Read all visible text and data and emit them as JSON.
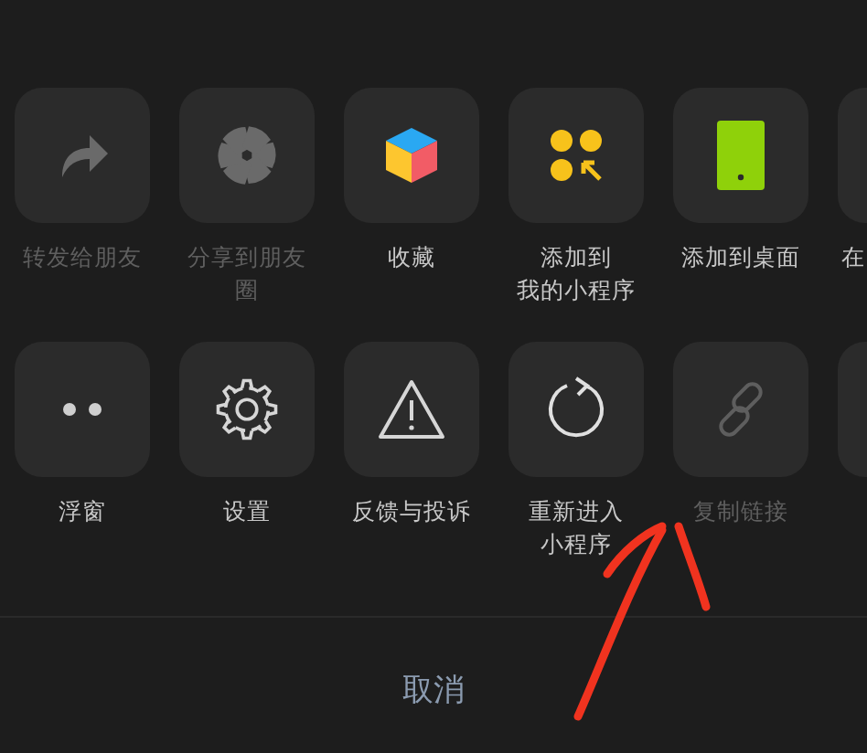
{
  "rows": [
    {
      "items": [
        {
          "kind": "tile",
          "lines": [
            "转发给朋友"
          ],
          "disabled": true
        },
        {
          "kind": "tile",
          "lines": [
            "分享到朋友",
            "圈"
          ],
          "disabled": true
        },
        {
          "kind": "tile",
          "lines": [
            "收藏"
          ],
          "disabled": false
        },
        {
          "kind": "tile",
          "lines": [
            "添加到",
            "我的小程序"
          ],
          "disabled": false
        },
        {
          "kind": "tile",
          "lines": [
            "添加到桌面"
          ],
          "disabled": false
        },
        {
          "kind": "edge",
          "lines": [
            "在"
          ]
        }
      ]
    },
    {
      "items": [
        {
          "kind": "tile",
          "lines": [
            "浮窗"
          ],
          "disabled": false
        },
        {
          "kind": "tile",
          "lines": [
            "设置"
          ],
          "disabled": false
        },
        {
          "kind": "tile",
          "lines": [
            "反馈与投诉"
          ],
          "disabled": false
        },
        {
          "kind": "tile",
          "lines": [
            "重新进入",
            "小程序"
          ],
          "disabled": false
        },
        {
          "kind": "tile",
          "lines": [
            "复制链接"
          ],
          "disabled": true
        },
        {
          "kind": "edge"
        }
      ]
    }
  ],
  "cancel": "取消"
}
